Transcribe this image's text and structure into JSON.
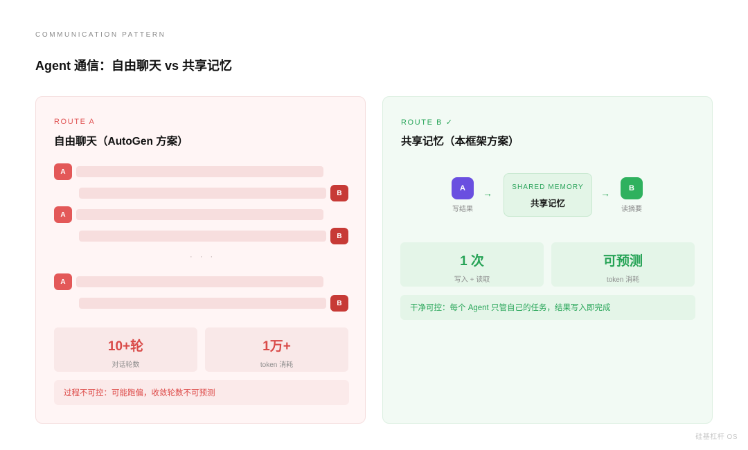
{
  "header": {
    "eyebrow": "COMMUNICATION PATTERN",
    "title": "Agent 通信：自由聊天 vs 共享记忆"
  },
  "route_a": {
    "label": "ROUTE A",
    "title": "自由聊天（AutoGen 方案）",
    "agent_a_label": "A",
    "agent_b_label": "B",
    "ellipsis": "· · ·",
    "stats": [
      {
        "value": "10+轮",
        "label": "对话轮数"
      },
      {
        "value": "1万+",
        "label": "token 消耗"
      }
    ],
    "note": "过程不可控：可能跑偏，收敛轮数不可预测"
  },
  "route_b": {
    "label": "ROUTE B ✓",
    "title": "共享记忆（本框架方案）",
    "flow": {
      "node_a": "A",
      "node_a_caption": "写结果",
      "arrow": "→",
      "memory_label": "SHARED MEMORY",
      "memory_name": "共享记忆",
      "node_b": "B",
      "node_b_caption": "读摘要"
    },
    "stats": [
      {
        "value": "1 次",
        "label": "写入 + 读取"
      },
      {
        "value": "可预测",
        "label": "token 消耗"
      }
    ],
    "note": "干净可控：每个 Agent 只管自己的任务，结果写入即完成"
  },
  "footer": {
    "watermark": "硅基杠杆 OS"
  },
  "colors": {
    "route_a_accent": "#e05252",
    "route_b_accent": "#27a558",
    "agent_a_node": "#6a4fe0",
    "agent_b_node": "#2fb15e"
  }
}
